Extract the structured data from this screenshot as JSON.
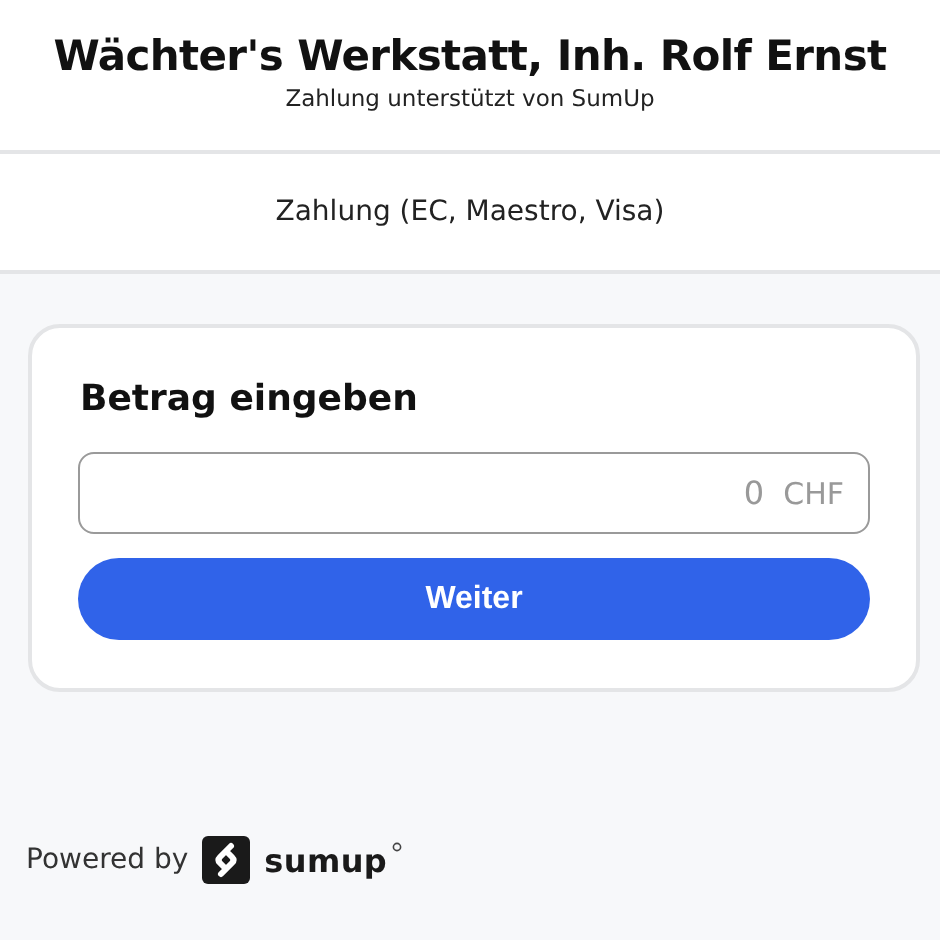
{
  "header": {
    "title": "Wächter's Werkstatt, Inh. Rolf Ernst",
    "subtitle": "Zahlung unterstützt von SumUp"
  },
  "payment_method": "Zahlung (EC, Maestro, Visa)",
  "card": {
    "heading": "Betrag eingeben",
    "amount_field": {
      "placeholder": "0",
      "currency": "CHF"
    },
    "button": "Weiter"
  },
  "footer": {
    "label": "Powered by",
    "brand": "sumup"
  }
}
